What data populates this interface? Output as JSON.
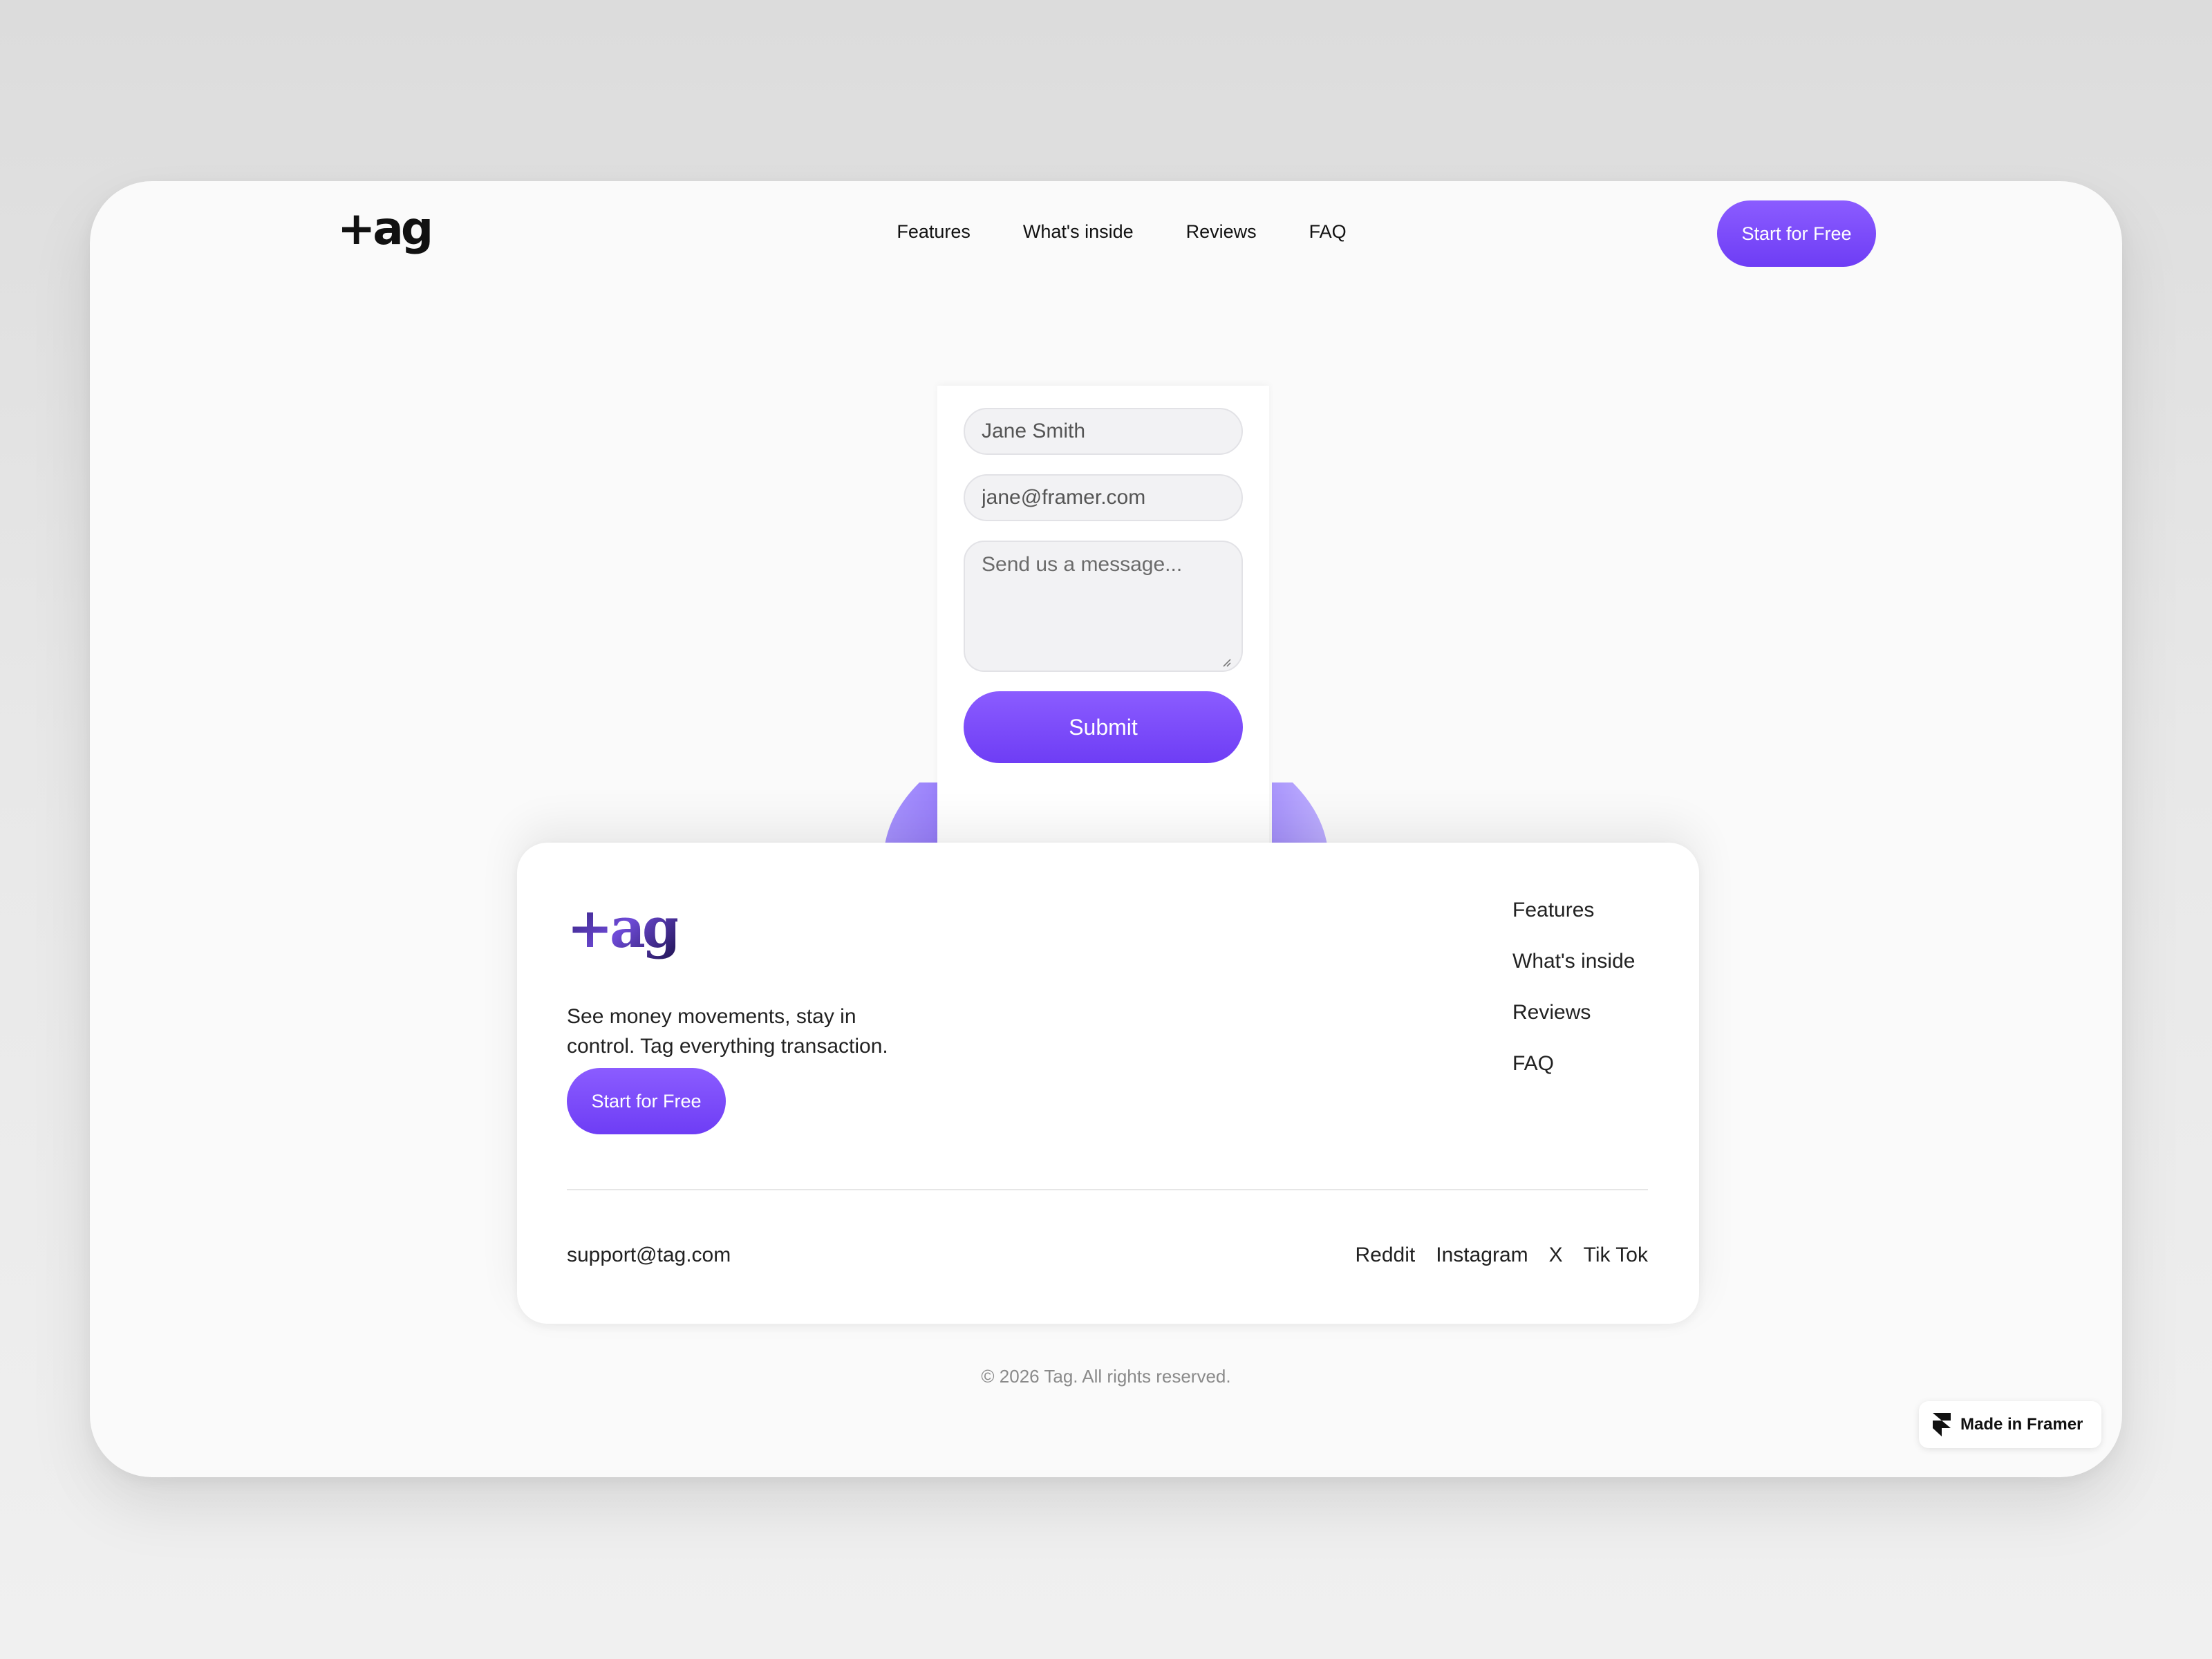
{
  "brand": {
    "logo": "+ag",
    "accent": "#7c4dff"
  },
  "header": {
    "nav": [
      "Features",
      "What's inside",
      "Reviews",
      "FAQ"
    ],
    "cta": "Start for Free"
  },
  "form": {
    "name_value": "Jane Smith",
    "email_value": "jane@framer.com",
    "message_placeholder": "Send us a message...",
    "submit_label": "Submit"
  },
  "footer_card": {
    "logo": "+ag",
    "tagline": "See money movements, stay in control. Tag everything transaction.",
    "cta": "Start for Free",
    "links": [
      "Features",
      "What's inside",
      "Reviews",
      "FAQ"
    ],
    "email": "support@tag.com",
    "socials": [
      "Reddit",
      "Instagram",
      "X",
      "Tik Tok"
    ]
  },
  "copyright": "© 2026 Tag. All rights reserved.",
  "badge": {
    "label": "Made in Framer",
    "icon": "framer-icon"
  }
}
